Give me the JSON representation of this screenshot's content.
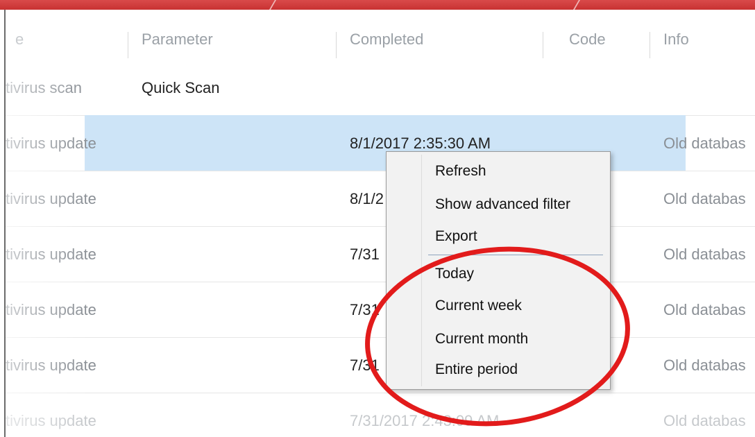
{
  "table": {
    "headers": {
      "type": "e",
      "parameter": "Parameter",
      "completed": "Completed",
      "code": "Code",
      "info": "Info"
    },
    "rows": [
      {
        "type": "tivirus scan",
        "parameter": "Quick Scan",
        "completed": "",
        "info": ""
      },
      {
        "type": "tivirus update",
        "parameter": "",
        "completed": "8/1/2017 2:35:30 AM",
        "info": "Old databas"
      },
      {
        "type": "tivirus update",
        "parameter": "",
        "completed": "8/1/2",
        "info": "Old databas"
      },
      {
        "type": "tivirus update",
        "parameter": "",
        "completed": "7/31",
        "info": "Old databas"
      },
      {
        "type": "tivirus update",
        "parameter": "",
        "completed": "7/31",
        "info": "Old databas"
      },
      {
        "type": "tivirus update",
        "parameter": "",
        "completed": "7/31",
        "info": "Old databas"
      },
      {
        "type": "tivirus update",
        "parameter": "",
        "completed": "7/31/2017 2:43:09 AM",
        "info": "Old databas"
      }
    ]
  },
  "context_menu": {
    "items": [
      "Refresh",
      "Show advanced filter",
      "Export",
      "Today",
      "Current week",
      "Current month",
      "Entire period"
    ]
  },
  "colors": {
    "selection": "#cde4f7",
    "annotation": "#e21b1b",
    "title_bar": "#c83232"
  }
}
